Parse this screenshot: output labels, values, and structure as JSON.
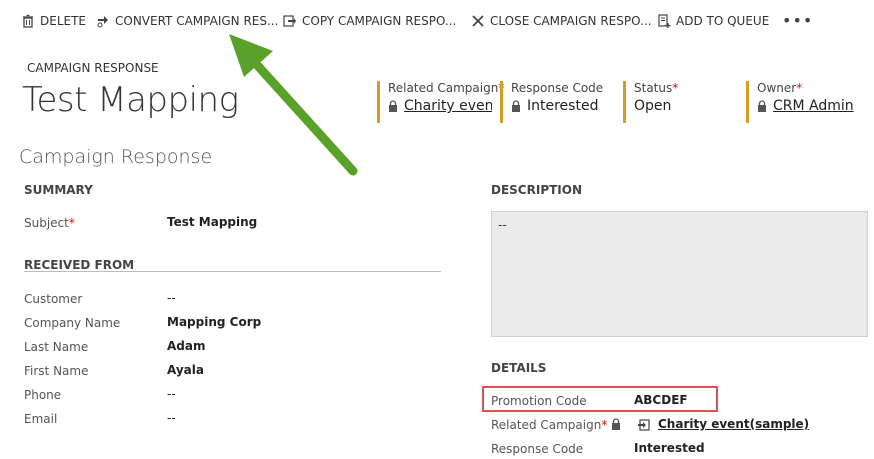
{
  "toolbar": {
    "delete_label": "DELETE",
    "convert_label": "CONVERT CAMPAIGN RES...",
    "copy_label": "COPY CAMPAIGN RESPO...",
    "close_label": "CLOSE CAMPAIGN RESPO...",
    "queue_label": "ADD TO QUEUE",
    "more_label": "•••"
  },
  "header": {
    "entity_type": "CAMPAIGN RESPONSE",
    "title": "Test Mapping",
    "fields": [
      {
        "label": "Related Campaign",
        "required": true,
        "value": "Charity event(sample)",
        "locked": true,
        "link": true
      },
      {
        "label": "Response Code",
        "required": false,
        "value": "Interested",
        "locked": true,
        "link": false
      },
      {
        "label": "Status",
        "required": true,
        "value": "Open",
        "locked": false,
        "link": false
      },
      {
        "label": "Owner",
        "required": true,
        "value": "CRM Admin",
        "locked": true,
        "link": true
      }
    ]
  },
  "form_title": "Campaign Response",
  "summary": {
    "heading": "SUMMARY",
    "subject_label": "Subject",
    "subject_value": "Test Mapping"
  },
  "received_from": {
    "heading": "RECEIVED FROM",
    "rows": [
      {
        "label": "Customer",
        "value": "--"
      },
      {
        "label": "Company Name",
        "value": "Mapping Corp"
      },
      {
        "label": "Last Name",
        "value": "Adam"
      },
      {
        "label": "First Name",
        "value": "Ayala"
      },
      {
        "label": "Phone",
        "value": "--"
      },
      {
        "label": "Email",
        "value": "--"
      }
    ]
  },
  "description": {
    "heading": "DESCRIPTION",
    "value": "--"
  },
  "details": {
    "heading": "DETAILS",
    "promotion_label": "Promotion Code",
    "promotion_value": "ABCDEF",
    "campaign_label": "Related Campaign",
    "campaign_value": "Charity event(sample)",
    "response_label": "Response Code",
    "response_value": "Interested"
  },
  "required_marker": "*",
  "colors": {
    "accent_bar": "#d89c23",
    "required": "#e00000",
    "highlight_box": "#d9534f",
    "arrow": "#5aa12a"
  }
}
